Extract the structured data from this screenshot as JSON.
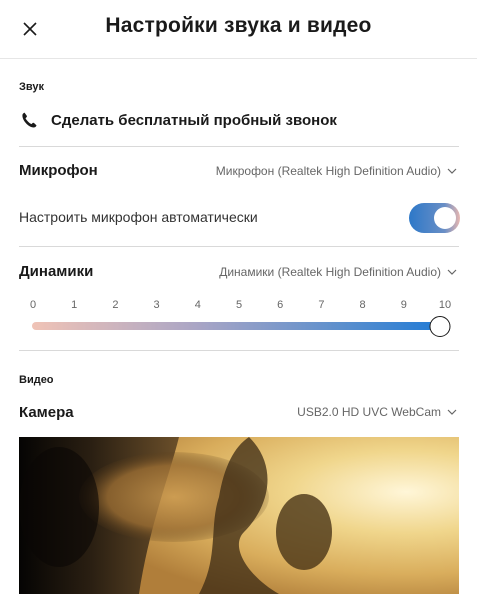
{
  "header": {
    "title": "Настройки звука и видео"
  },
  "audio": {
    "section_label": "Звук",
    "test_call_label": "Сделать бесплатный пробный звонок",
    "microphone": {
      "title": "Микрофон",
      "selected_device": "Микрофон (Realtek High Definition Audio)",
      "auto_adjust_label": "Настроить микрофон автоматически",
      "auto_adjust_enabled": true
    },
    "speakers": {
      "title": "Динамики",
      "selected_device": "Динамики (Realtek High Definition Audio)",
      "volume_ticks": [
        "0",
        "1",
        "2",
        "3",
        "4",
        "5",
        "6",
        "7",
        "8",
        "9",
        "10"
      ],
      "volume_value": 10,
      "volume_max": 10
    }
  },
  "video": {
    "section_label": "Видео",
    "camera": {
      "title": "Камера",
      "selected_device": "USB2.0 HD UVC WebCam"
    }
  },
  "colors": {
    "toggle_on": "#2d78c8",
    "slider_start": "#f0c3b6",
    "slider_end": "#1e7ad6",
    "divider": "#d9d9d9"
  },
  "icons": {
    "close": "close-icon",
    "phone": "phone-icon",
    "chevron": "chevron-down-icon"
  }
}
